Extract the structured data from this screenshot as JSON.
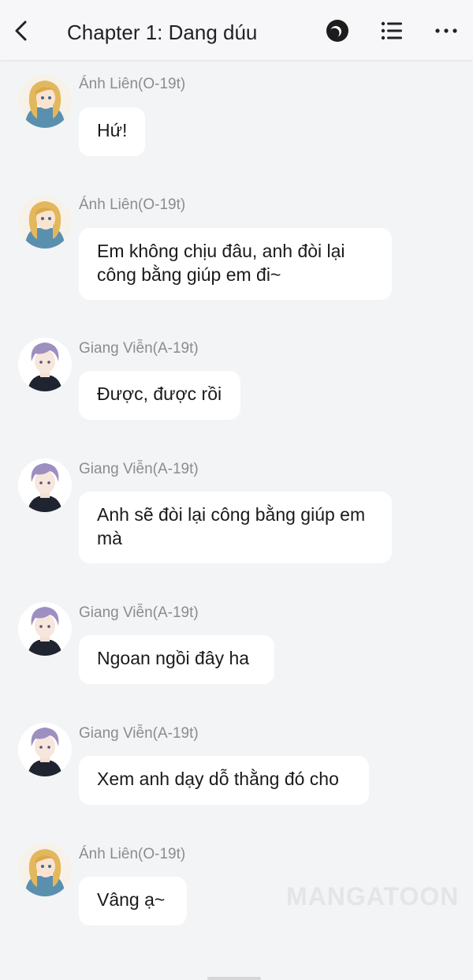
{
  "header": {
    "title": "Chapter 1: Dang dúu"
  },
  "messages": [
    {
      "sender": "Ánh Liên(O-19t)",
      "text": "Hứ!",
      "avatar": "blonde-girl-avatar"
    },
    {
      "sender": "Ánh Liên(O-19t)",
      "text": "Em không chịu đâu, anh đòi lại công bằng giúp em đi~",
      "avatar": "blonde-girl-avatar"
    },
    {
      "sender": "Giang Viễn(A-19t)",
      "text": "Được, được rồi",
      "avatar": "purple-hair-boy-avatar"
    },
    {
      "sender": "Giang Viễn(A-19t)",
      "text": "Anh sẽ đòi lại công bằng giúp em mà",
      "avatar": "purple-hair-boy-avatar"
    },
    {
      "sender": "Giang Viễn(A-19t)",
      "text": "Ngoan ngồi đây ha",
      "avatar": "purple-hair-boy-avatar"
    },
    {
      "sender": "Giang Viễn(A-19t)",
      "text": "Xem anh dạy dỗ thằng đó cho",
      "avatar": "purple-hair-boy-avatar"
    },
    {
      "sender": "Ánh Liên(O-19t)",
      "text": "Vâng ạ~",
      "avatar": "blonde-girl-avatar"
    }
  ],
  "watermark": "MANGATOON"
}
